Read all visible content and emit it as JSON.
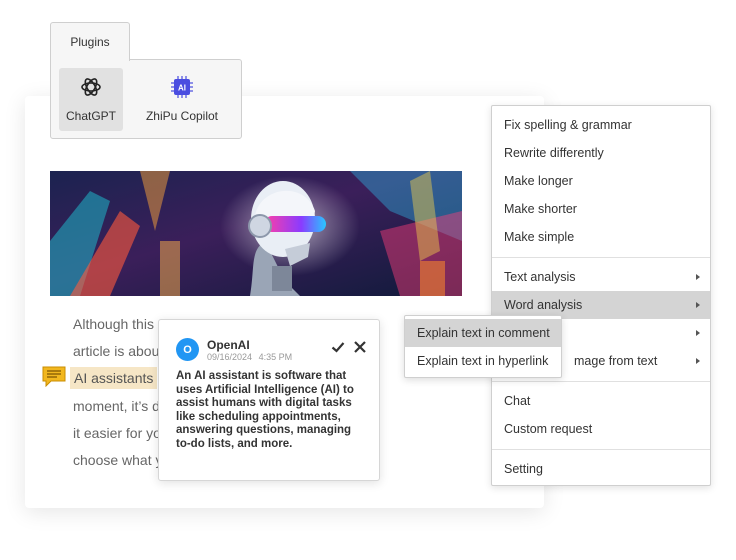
{
  "plugins": {
    "tab_label": "Plugins",
    "items": [
      {
        "label": "ChatGPT",
        "icon": "openai-logo-icon",
        "active": true
      },
      {
        "label": "ZhiPu Copilot",
        "icon": "ai-chip-icon",
        "active": false
      }
    ],
    "chip_text": "AI"
  },
  "document": {
    "lines": [
      "Although this",
      "article is about",
      "moment, it’s di",
      "it easier for you",
      "choose what yo"
    ],
    "highlighted_text": "AI assistants"
  },
  "comment": {
    "avatar_letter": "O",
    "author": "OpenAI",
    "date": "09/16/2024",
    "time": "4:35 PM",
    "text": "An AI assistant is software that uses Artificial Intelligence (AI) to assist humans with digital tasks like scheduling appointments, answering questions, managing to-do lists, and more."
  },
  "context_menu": {
    "group1": [
      "Fix spelling & grammar",
      "Rewrite differently",
      "Make longer",
      "Make shorter",
      "Make simple"
    ],
    "group2": [
      {
        "label": "Text analysis",
        "has_submenu": true
      },
      {
        "label": "Word analysis",
        "has_submenu": true,
        "highlighted": true
      },
      {
        "label": "",
        "has_submenu": true
      },
      {
        "label": "mage from text",
        "has_submenu": true
      }
    ],
    "group3": [
      "Chat",
      "Custom request"
    ],
    "group4": [
      "Setting"
    ]
  },
  "submenu": {
    "items": [
      {
        "label": "Explain text in comment",
        "highlighted": true
      },
      {
        "label": "Explain text in hyperlink",
        "highlighted": false
      }
    ]
  },
  "colors": {
    "avatar": "#2196f3",
    "highlight": "#f6e6c6",
    "menu_hover": "#d4d4d4",
    "marker": "#f2b71f"
  }
}
